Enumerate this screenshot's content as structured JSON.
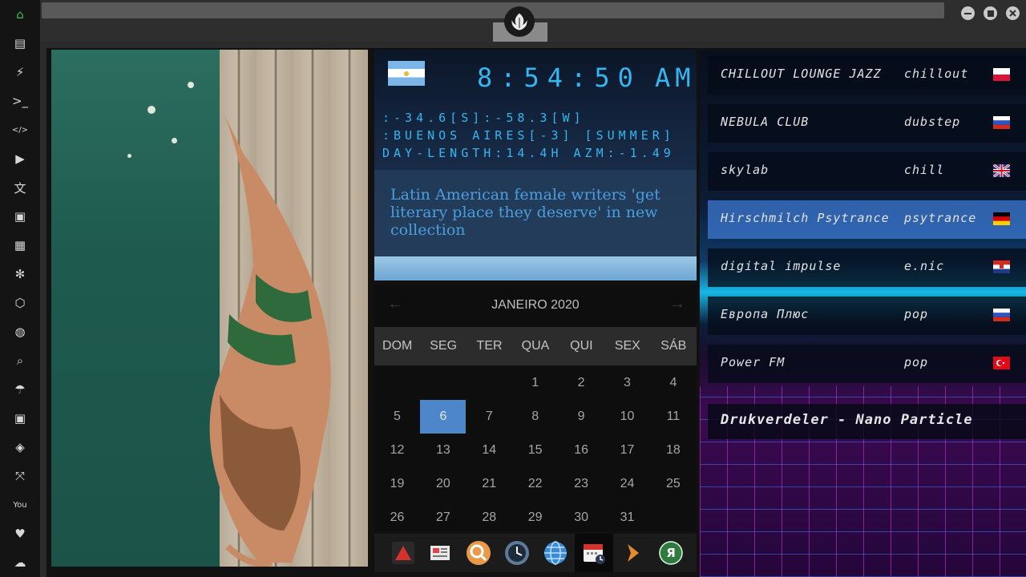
{
  "sidebar": {
    "items": [
      {
        "name": "home-icon",
        "glyph": "⌂"
      },
      {
        "name": "document-icon",
        "glyph": "▤"
      },
      {
        "name": "lightning-icon",
        "glyph": "⚡"
      },
      {
        "name": "terminal-icon",
        "glyph": ">_"
      },
      {
        "name": "code-icon",
        "glyph": "</>"
      },
      {
        "name": "play-icon",
        "glyph": "▶"
      },
      {
        "name": "translate-icon",
        "glyph": "文"
      },
      {
        "name": "image-icon",
        "glyph": "▣"
      },
      {
        "name": "news-icon",
        "glyph": "▦"
      },
      {
        "name": "aperture-icon",
        "glyph": "✻"
      },
      {
        "name": "hexagon-icon",
        "glyph": "⬡"
      },
      {
        "name": "globe-icon",
        "glyph": "◍"
      },
      {
        "name": "search-icon",
        "glyph": "⌕"
      },
      {
        "name": "umbrella-icon",
        "glyph": "☂"
      },
      {
        "name": "contacts-icon",
        "glyph": "▣"
      },
      {
        "name": "diamond-link-icon",
        "glyph": "◈"
      },
      {
        "name": "expand-icon",
        "glyph": "⤧"
      },
      {
        "name": "youtube-icon",
        "glyph": "You"
      },
      {
        "name": "heart-icon",
        "glyph": "♥"
      },
      {
        "name": "cloud-icon",
        "glyph": "☁"
      }
    ],
    "active_color": "#39c24a"
  },
  "clock": {
    "time": "8:54:50",
    "ampm": "AM",
    "coords": ":-34.6[S]:-58.3[W]",
    "city": ":BUENOS AIRES[-3] [SUMMER]",
    "day": "DAY-LENGTH:14.4H AZM:-1.49"
  },
  "news": {
    "headline": "Latin American female writers 'get literary place they deserve' in new collection"
  },
  "calendar": {
    "month": "JANEIRO 2020",
    "prev": "←",
    "next": "→",
    "weekdays": [
      "DOM",
      "SEG",
      "TER",
      "QUA",
      "QUI",
      "SEX",
      "SÁB"
    ],
    "weeks": [
      [
        "",
        "",
        "",
        "1",
        "2",
        "3",
        "4"
      ],
      [
        "5",
        "6",
        "7",
        "8",
        "9",
        "10",
        "11"
      ],
      [
        "12",
        "13",
        "14",
        "15",
        "16",
        "17",
        "18"
      ],
      [
        "19",
        "20",
        "21",
        "22",
        "23",
        "24",
        "25"
      ],
      [
        "26",
        "27",
        "28",
        "29",
        "30",
        "31",
        ""
      ]
    ],
    "today": "6",
    "highlight_color": "#4d86c9"
  },
  "radio": {
    "stations": [
      {
        "name": "CHILLOUT LOUNGE JAZZ",
        "genre": "chillout",
        "flag": "PL"
      },
      {
        "name": "NEBULA CLUB",
        "genre": "dubstep",
        "flag": "RU"
      },
      {
        "name": "skylab",
        "genre": "chill",
        "flag": "GB"
      },
      {
        "name": "Hirschmilch Psytrance",
        "genre": "psytrance",
        "flag": "DE"
      },
      {
        "name": "digital impulse",
        "genre": "e.nic",
        "flag": "HR"
      },
      {
        "name": "Европа Плюс",
        "genre": "pop",
        "flag": "RU"
      },
      {
        "name": "Power FM",
        "genre": "pop",
        "flag": "TR"
      }
    ],
    "active_index": 3,
    "now_playing": "Drukverdeler - Nano Particle"
  },
  "dock": {
    "apps": [
      {
        "name": "app-red-triangle-icon"
      },
      {
        "name": "app-news-icon"
      },
      {
        "name": "app-search-icon"
      },
      {
        "name": "app-clock-icon"
      },
      {
        "name": "app-globe-icon"
      },
      {
        "name": "app-calendar-icon"
      },
      {
        "name": "app-play-icon"
      },
      {
        "name": "app-yandex-icon",
        "label": "Я"
      }
    ],
    "active_index": 5
  }
}
